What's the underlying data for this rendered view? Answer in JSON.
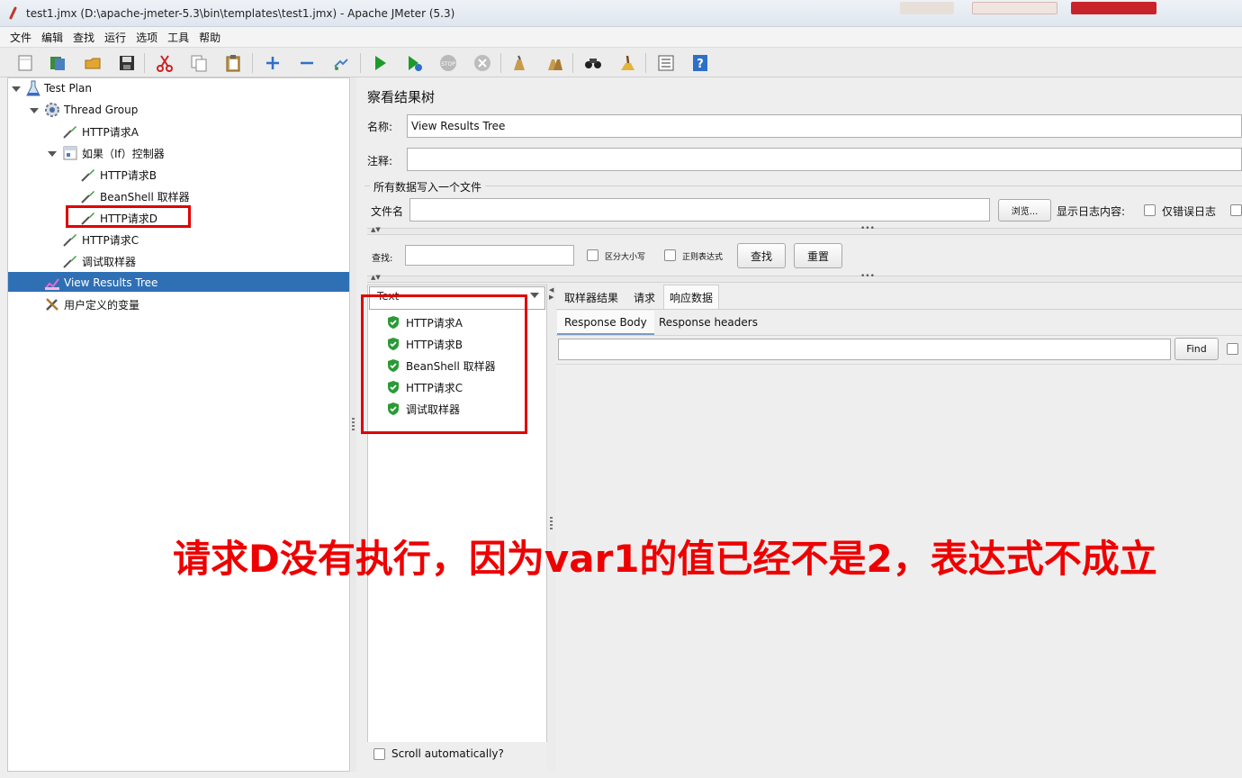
{
  "window": {
    "title": "test1.jmx (D:\\apache-jmeter-5.3\\bin\\templates\\test1.jmx) - Apache JMeter (5.3)"
  },
  "menu": [
    "文件",
    "编辑",
    "查找",
    "运行",
    "选项",
    "工具",
    "帮助"
  ],
  "toolbar": {
    "icons": [
      "new-icon",
      "templates-icon",
      "open-icon",
      "save-icon",
      "cut-icon",
      "copy-icon",
      "paste-icon",
      "expand-icon",
      "collapse-icon",
      "toggle-icon",
      "start-icon",
      "start-no-pause-icon",
      "stop-icon",
      "shutdown-icon",
      "clear-icon",
      "clear-all-icon",
      "search-icon",
      "reset-search-icon",
      "function-helper-icon",
      "help-icon"
    ]
  },
  "tree": {
    "items": [
      {
        "label": "Test Plan",
        "icon": "test-plan-icon"
      },
      {
        "label": "Thread Group",
        "icon": "thread-group-icon"
      },
      {
        "label": "HTTP请求A",
        "icon": "sampler-icon"
      },
      {
        "label": "如果（If）控制器",
        "icon": "if-controller-icon"
      },
      {
        "label": "HTTP请求B",
        "icon": "sampler-icon"
      },
      {
        "label": "BeanShell 取样器",
        "icon": "sampler-icon"
      },
      {
        "label": "HTTP请求D",
        "icon": "sampler-icon"
      },
      {
        "label": "HTTP请求C",
        "icon": "sampler-icon"
      },
      {
        "label": "调试取样器",
        "icon": "sampler-icon"
      },
      {
        "label": "View Results Tree",
        "icon": "listener-icon"
      },
      {
        "label": "用户定义的变量",
        "icon": "config-icon"
      }
    ],
    "selected": "View Results Tree"
  },
  "panel": {
    "heading": "察看结果树",
    "name_label": "名称:",
    "name_value": "View Results Tree",
    "comment_label": "注释:",
    "comment_value": "",
    "file_group_label": "所有数据写入一个文件",
    "filename_label": "文件名",
    "filename_value": "",
    "browse_button": "浏览...",
    "log_content_label": "显示日志内容:",
    "errors_only_label": "仅错误日志",
    "search_label": "查找:",
    "search_value": "",
    "case_sensitive_label": "区分大小写",
    "regex_label": "正则表达式",
    "find_button": "查找",
    "reset_button": "重置"
  },
  "results": {
    "renderer": "Text",
    "items": [
      "HTTP请求A",
      "HTTP请求B",
      "BeanShell 取样器",
      "HTTP请求C",
      "调试取样器"
    ],
    "scroll_auto_label": "Scroll automatically?"
  },
  "detail": {
    "tabs": [
      "取样器结果",
      "请求",
      "响应数据"
    ],
    "active_tab": "响应数据",
    "subtabs": [
      "Response Body",
      "Response headers"
    ],
    "active_subtab": "Response Body",
    "find_button": "Find"
  },
  "annotation": {
    "text": "请求D没有执行，因为var1的值已经不是2，表达式不成立",
    "color": "#ee0000"
  }
}
